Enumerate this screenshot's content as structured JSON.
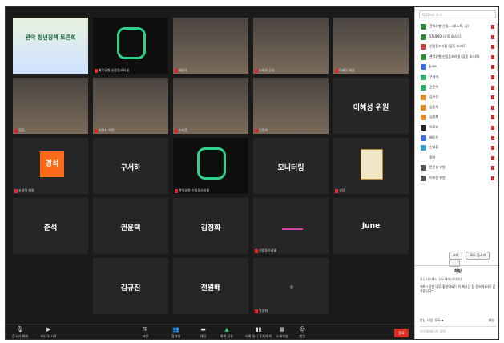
{
  "tiles": [
    {
      "name": "",
      "big": "관악 청년정책 토론회",
      "kind": "poster"
    },
    {
      "name": "관악유향 신림동쓰리룸",
      "big": "",
      "kind": "logo"
    },
    {
      "name": "배진우",
      "big": "",
      "kind": "cam"
    },
    {
      "name": "조하은 공유",
      "big": "",
      "kind": "cam"
    },
    {
      "name": "이혜진 위원",
      "big": "",
      "kind": "cam"
    },
    {
      "name": "전진",
      "big": "",
      "kind": "cam"
    },
    {
      "name": "최현지 위원",
      "big": "",
      "kind": "cam"
    },
    {
      "name": "신재훈",
      "big": "",
      "kind": "cam"
    },
    {
      "name": "김동희",
      "big": "",
      "kind": "cam"
    },
    {
      "name": "",
      "big": "이혜성 위원",
      "kind": "text"
    },
    {
      "name": "조경석 위원",
      "big": "경석",
      "kind": "orange"
    },
    {
      "name": "",
      "big": "구서하",
      "kind": "text"
    },
    {
      "name": "관악유향 신림동쓰리룸",
      "big": "",
      "kind": "logo"
    },
    {
      "name": "",
      "big": "모니터링",
      "kind": "text"
    },
    {
      "name": "생강",
      "big": "",
      "kind": "book"
    },
    {
      "name": "",
      "big": "준석",
      "kind": "text"
    },
    {
      "name": "",
      "big": "권윤택",
      "kind": "text"
    },
    {
      "name": "",
      "big": "김정화",
      "kind": "text"
    },
    {
      "name": "신림동쓰리룸",
      "big": "",
      "kind": "purple"
    },
    {
      "name": "",
      "big": "June",
      "kind": "text"
    },
    {
      "name": "",
      "big": "",
      "kind": "empty"
    },
    {
      "name": "",
      "big": "김규진",
      "kind": "text"
    },
    {
      "name": "",
      "big": "전원배",
      "kind": "text"
    },
    {
      "name": "학생회",
      "big": "",
      "kind": "dot"
    },
    {
      "name": "",
      "big": "",
      "kind": "empty"
    }
  ],
  "search_placeholder": "Q 참가자 찾기",
  "participants": [
    {
      "name": "관악유향 신림... (호스트, 나)",
      "color": "#2d8a3a"
    },
    {
      "name": "STUDIO (공동 호스트)",
      "color": "#2d8a3a"
    },
    {
      "name": "신림동쓰리룸 (공동 호스트)",
      "color": "#c44"
    },
    {
      "name": "관악유향 신림동쓰리룸 (공동 호스트)",
      "color": "#2d8a3a"
    },
    {
      "name": "June",
      "color": "#3a6fd8"
    },
    {
      "name": "구서하",
      "color": "#2fb06a"
    },
    {
      "name": "권윤택",
      "color": "#2fb06a"
    },
    {
      "name": "김규진",
      "color": "#e08a2a"
    },
    {
      "name": "김동희",
      "color": "#e08a2a"
    },
    {
      "name": "김정화",
      "color": "#e08a2a"
    },
    {
      "name": "독로회",
      "color": "#222"
    },
    {
      "name": "배진우",
      "color": "#3a6fd8"
    },
    {
      "name": "신재훈",
      "color": "#2fa0d0"
    },
    {
      "name": "정석",
      "color": "#fff"
    },
    {
      "name": "문민성 위원",
      "color": "#555"
    },
    {
      "name": "이하진 위원",
      "color": "#555"
    }
  ],
  "panel_buttons": [
    "초대",
    "모두 음소거",
    "..."
  ],
  "chat": {
    "title": "채팅",
    "from": "홍길사이에서 모두에게(이야기)",
    "message": "저희~공연 너무 좋았어요!! 저 제시간 참 정되어요오! 감사합니다~",
    "to_label": "받는 사람: 모두 ▾",
    "file_label": "파일",
    "input_placeholder": "여기에 메시지 입력..."
  },
  "toolbar": {
    "mute": "음소거 해제",
    "video": "비디오 시작",
    "security": "보안",
    "participants": "참가자",
    "participant_count": "25",
    "chat": "채팅",
    "share": "화면 공유",
    "record": "기록 일시 중지/중지",
    "breakout": "소회의실",
    "reactions": "반응",
    "end": "종료"
  }
}
